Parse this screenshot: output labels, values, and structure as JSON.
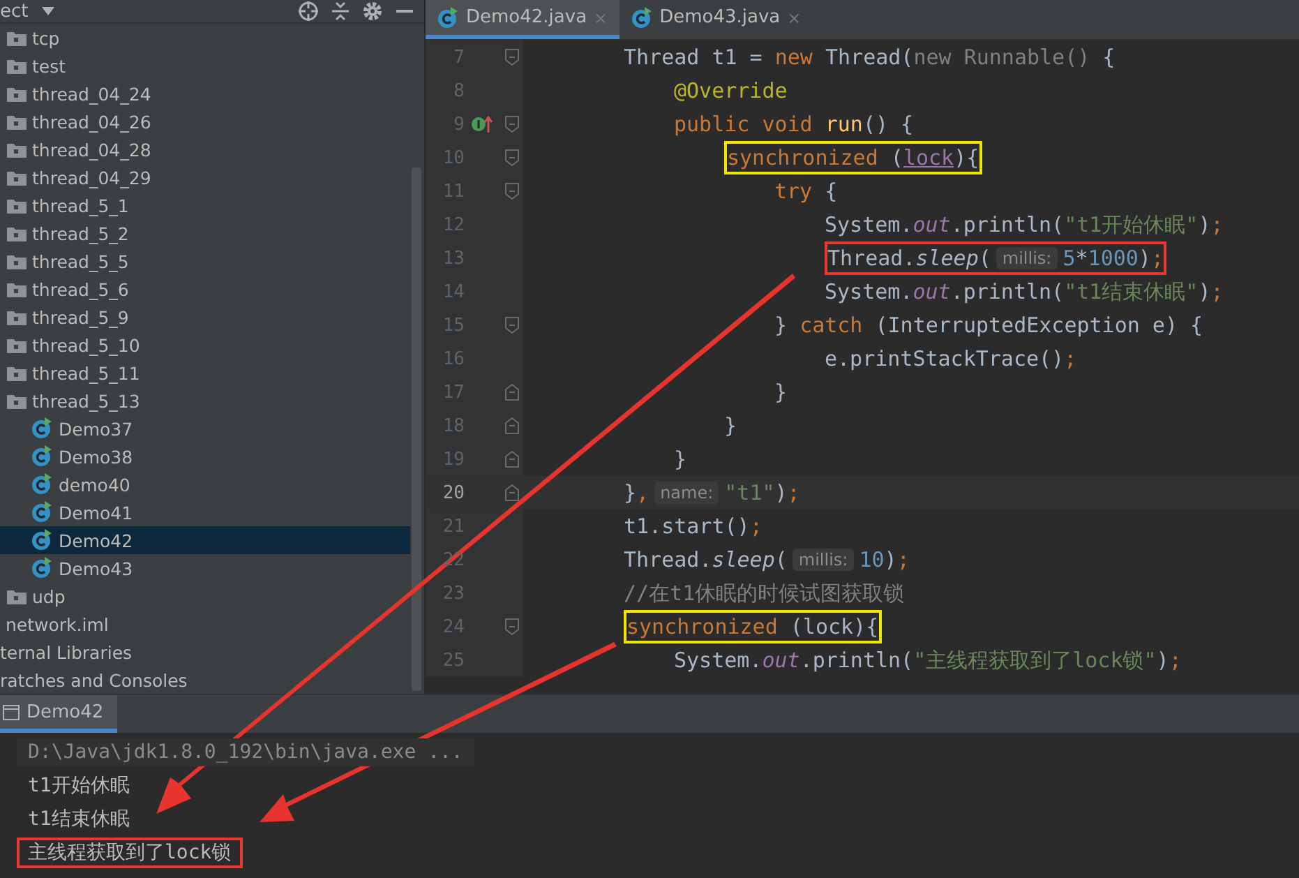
{
  "project_panel": {
    "title": "ect",
    "tree": [
      {
        "kind": "folder",
        "label": "tcp",
        "selected": false
      },
      {
        "kind": "folder",
        "label": "test",
        "selected": false
      },
      {
        "kind": "folder",
        "label": "thread_04_24",
        "selected": false
      },
      {
        "kind": "folder",
        "label": "thread_04_26",
        "selected": false
      },
      {
        "kind": "folder",
        "label": "thread_04_28",
        "selected": false
      },
      {
        "kind": "folder",
        "label": "thread_04_29",
        "selected": false
      },
      {
        "kind": "folder",
        "label": "thread_5_1",
        "selected": false
      },
      {
        "kind": "folder",
        "label": "thread_5_2",
        "selected": false
      },
      {
        "kind": "folder",
        "label": "thread_5_5",
        "selected": false
      },
      {
        "kind": "folder",
        "label": "thread_5_6",
        "selected": false
      },
      {
        "kind": "folder",
        "label": "thread_5_9",
        "selected": false
      },
      {
        "kind": "folder",
        "label": "thread_5_10",
        "selected": false
      },
      {
        "kind": "folder",
        "label": "thread_5_11",
        "selected": false
      },
      {
        "kind": "folder",
        "label": "thread_5_13",
        "selected": false,
        "children": [
          {
            "kind": "class",
            "label": "Demo37",
            "selected": false
          },
          {
            "kind": "class",
            "label": "Demo38",
            "selected": false
          },
          {
            "kind": "class",
            "label": "demo40",
            "selected": false
          },
          {
            "kind": "class",
            "label": "Demo41",
            "selected": false
          },
          {
            "kind": "class",
            "label": "Demo42",
            "selected": true
          },
          {
            "kind": "class",
            "label": "Demo43",
            "selected": false
          }
        ]
      },
      {
        "kind": "folder",
        "label": "udp",
        "selected": false
      },
      {
        "kind": "file",
        "label": "network.iml",
        "selected": false
      },
      {
        "kind": "group",
        "label": "ternal Libraries",
        "selected": false
      },
      {
        "kind": "group",
        "label": "ratches and Consoles",
        "selected": false
      }
    ]
  },
  "editor": {
    "tabs": [
      {
        "label": "Demo42.java",
        "close": "×",
        "selected": true
      },
      {
        "label": "Demo43.java",
        "close": "×",
        "selected": false
      }
    ],
    "lines": [
      {
        "number": "7",
        "override": false,
        "closes_block": false,
        "current": false,
        "tokens": [
          {
            "kind": "text",
            "text": "Thread t1 = "
          },
          {
            "kind": "keyword",
            "text": "new"
          },
          {
            "kind": "text",
            "text": " Thread("
          },
          {
            "kind": "dim",
            "text": "new Runnable()"
          },
          {
            "kind": "text",
            "text": " {"
          }
        ],
        "children": [
          {
            "number": "8",
            "override": false,
            "closes_block": false,
            "current": false,
            "tokens": [
              {
                "kind": "annotation",
                "text": "@Override"
              }
            ]
          },
          {
            "number": "9",
            "override": true,
            "closes_block": false,
            "current": false,
            "tokens": [
              {
                "kind": "keyword",
                "text": "public void "
              },
              {
                "kind": "method",
                "text": "run"
              },
              {
                "kind": "text",
                "text": "() {"
              }
            ],
            "children": [
              {
                "number": "10",
                "override": false,
                "closes_block": false,
                "current": false,
                "tokens": [
                  {
                    "kind": "box",
                    "color": "#f2e600",
                    "tokens": [
                      {
                        "kind": "keyword",
                        "text": "synchronized"
                      },
                      {
                        "kind": "text",
                        "text": " ("
                      },
                      {
                        "kind": "link",
                        "text": "lock"
                      },
                      {
                        "kind": "text",
                        "text": "){"
                      }
                    ]
                  }
                ],
                "children": [
                  {
                    "number": "11",
                    "override": false,
                    "closes_block": false,
                    "current": false,
                    "tokens": [
                      {
                        "kind": "keyword",
                        "text": "try"
                      },
                      {
                        "kind": "text",
                        "text": " {"
                      }
                    ],
                    "children": [
                      {
                        "number": "12",
                        "override": false,
                        "closes_block": false,
                        "current": false,
                        "tokens": [
                          {
                            "kind": "text",
                            "text": "System."
                          },
                          {
                            "kind": "field",
                            "text": "out"
                          },
                          {
                            "kind": "text",
                            "text": ".println("
                          },
                          {
                            "kind": "string",
                            "text": "\"t1开始休眠\""
                          },
                          {
                            "kind": "text",
                            "text": ")"
                          },
                          {
                            "kind": "keyword",
                            "text": ";"
                          }
                        ]
                      },
                      {
                        "number": "13",
                        "override": false,
                        "closes_block": false,
                        "current": false,
                        "tokens": [
                          {
                            "kind": "box",
                            "color": "#e53935",
                            "tokens": [
                              {
                                "kind": "text",
                                "text": "Thread."
                              },
                              {
                                "kind": "static",
                                "text": "sleep"
                              },
                              {
                                "kind": "text",
                                "text": "("
                              },
                              {
                                "kind": "hint",
                                "text": "millis:"
                              },
                              {
                                "kind": "number",
                                "text": "5"
                              },
                              {
                                "kind": "text",
                                "text": "*"
                              },
                              {
                                "kind": "number",
                                "text": "1000"
                              },
                              {
                                "kind": "text",
                                "text": ")"
                              },
                              {
                                "kind": "keyword",
                                "text": ";"
                              }
                            ]
                          }
                        ]
                      },
                      {
                        "number": "14",
                        "override": false,
                        "closes_block": false,
                        "current": false,
                        "tokens": [
                          {
                            "kind": "text",
                            "text": "System."
                          },
                          {
                            "kind": "field",
                            "text": "out"
                          },
                          {
                            "kind": "text",
                            "text": ".println("
                          },
                          {
                            "kind": "string",
                            "text": "\"t1结束休眠\""
                          },
                          {
                            "kind": "text",
                            "text": ")"
                          },
                          {
                            "kind": "keyword",
                            "text": ";"
                          }
                        ]
                      }
                    ]
                  },
                  {
                    "number": "15",
                    "override": false,
                    "closes_block": false,
                    "current": false,
                    "tokens": [
                      {
                        "kind": "text",
                        "text": "} "
                      },
                      {
                        "kind": "keyword",
                        "text": "catch"
                      },
                      {
                        "kind": "text",
                        "text": " (InterruptedException e) {"
                      }
                    ],
                    "children": [
                      {
                        "number": "16",
                        "override": false,
                        "closes_block": false,
                        "current": false,
                        "tokens": [
                          {
                            "kind": "text",
                            "text": "e.printStackTrace()"
                          },
                          {
                            "kind": "keyword",
                            "text": ";"
                          }
                        ]
                      }
                    ]
                  },
                  {
                    "number": "17",
                    "override": false,
                    "closes_block": true,
                    "current": false,
                    "tokens": [
                      {
                        "kind": "text",
                        "text": "}"
                      }
                    ]
                  }
                ]
              },
              {
                "number": "18",
                "override": false,
                "closes_block": true,
                "current": false,
                "tokens": [
                  {
                    "kind": "text",
                    "text": "}"
                  }
                ]
              }
            ]
          },
          {
            "number": "19",
            "override": false,
            "closes_block": true,
            "current": false,
            "tokens": [
              {
                "kind": "text",
                "text": "}"
              }
            ]
          }
        ]
      },
      {
        "number": "20",
        "override": false,
        "closes_block": true,
        "current": true,
        "tokens": [
          {
            "kind": "text",
            "text": "}"
          },
          {
            "kind": "keyword",
            "text": ","
          },
          {
            "kind": "hint",
            "text": "name:"
          },
          {
            "kind": "string",
            "text": "\"t1\""
          },
          {
            "kind": "text",
            "text": ")"
          },
          {
            "kind": "keyword",
            "text": ";"
          }
        ]
      },
      {
        "number": "21",
        "override": false,
        "closes_block": false,
        "current": false,
        "tokens": [
          {
            "kind": "text",
            "text": "t1.start()"
          },
          {
            "kind": "keyword",
            "text": ";"
          }
        ]
      },
      {
        "number": "22",
        "override": false,
        "closes_block": false,
        "current": false,
        "tokens": [
          {
            "kind": "text",
            "text": "Thread."
          },
          {
            "kind": "static",
            "text": "sleep"
          },
          {
            "kind": "text",
            "text": "("
          },
          {
            "kind": "hint",
            "text": "millis:"
          },
          {
            "kind": "number",
            "text": "10"
          },
          {
            "kind": "text",
            "text": ")"
          },
          {
            "kind": "keyword",
            "text": ";"
          }
        ]
      },
      {
        "number": "23",
        "override": false,
        "closes_block": false,
        "current": false,
        "tokens": [
          {
            "kind": "comment",
            "text": "//在t1休眠的时候试图获取锁"
          }
        ]
      },
      {
        "number": "24",
        "override": false,
        "closes_block": false,
        "current": false,
        "tokens": [
          {
            "kind": "box",
            "color": "#f2e600",
            "tokens": [
              {
                "kind": "keyword",
                "text": "synchronized"
              },
              {
                "kind": "text",
                "text": " (lock){"
              }
            ]
          }
        ],
        "children": [
          {
            "number": "25",
            "override": false,
            "closes_block": false,
            "current": false,
            "tokens": [
              {
                "kind": "text",
                "text": "System."
              },
              {
                "kind": "field",
                "text": "out"
              },
              {
                "kind": "text",
                "text": ".println("
              },
              {
                "kind": "string",
                "text": "\"主线程获取到了lock锁\""
              },
              {
                "kind": "text",
                "text": ")"
              },
              {
                "kind": "keyword",
                "text": ";"
              }
            ]
          }
        ]
      }
    ]
  },
  "run_panel": {
    "tabs": [
      {
        "label": "Demo42",
        "selected": true
      }
    ],
    "lines": [
      {
        "kind": "command",
        "text": "D:\\Java\\jdk1.8.0_192\\bin\\java.exe ..."
      },
      {
        "kind": "output",
        "text": "t1开始休眠"
      },
      {
        "kind": "output",
        "text": "t1结束休眠"
      },
      {
        "kind": "output",
        "text": "主线程获取到了lock锁",
        "color": "#e53935"
      }
    ]
  }
}
